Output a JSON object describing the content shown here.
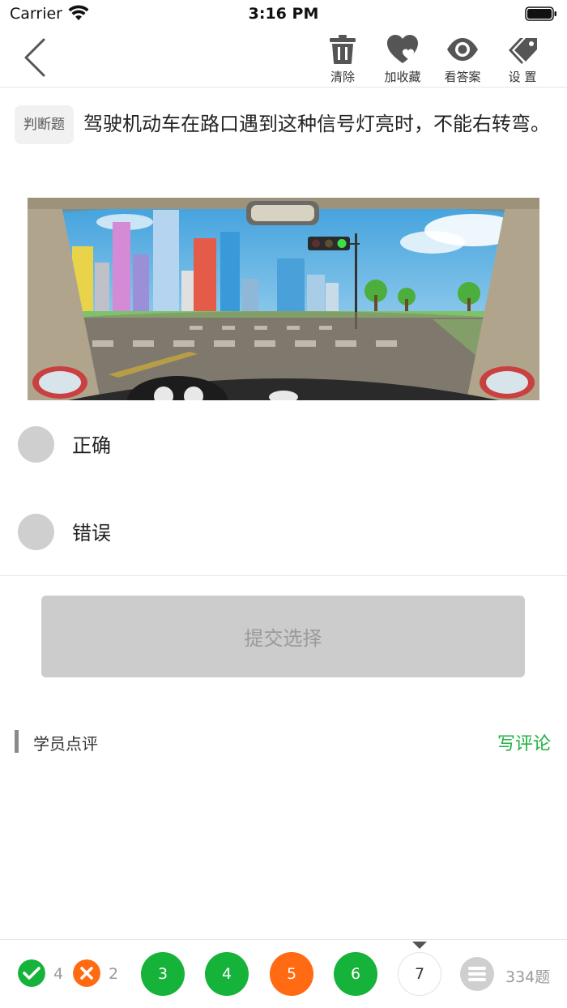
{
  "status_bar": {
    "carrier": "Carrier",
    "time": "3:16 PM"
  },
  "toolbar": {
    "back_icon": "chevron-left-icon",
    "items": [
      {
        "label": "清除",
        "icon": "trash-icon"
      },
      {
        "label": "加收藏",
        "icon": "heart-icon"
      },
      {
        "label": "看答案",
        "icon": "eye-icon"
      },
      {
        "label": "设 置",
        "icon": "tags-icon"
      }
    ]
  },
  "question": {
    "type_tag": "判断题",
    "text": "驾驶机动车在路口遇到这种信号灯亮时，不能右转弯。",
    "image_icon": "driver-view-traffic-light-illustration"
  },
  "options": [
    {
      "label": "正确"
    },
    {
      "label": "错误"
    }
  ],
  "submit_label": "提交选择",
  "comments": {
    "title": "学员点评",
    "write_label": "写评论"
  },
  "bottom_bar": {
    "correct_count": "4",
    "wrong_count": "2",
    "question_numbers": [
      {
        "num": "3",
        "state": "correct"
      },
      {
        "num": "4",
        "state": "correct"
      },
      {
        "num": "5",
        "state": "wrong"
      },
      {
        "num": "6",
        "state": "correct"
      },
      {
        "num": "7",
        "state": "current"
      }
    ],
    "total": "334题"
  },
  "colors": {
    "correct": "#16b33a",
    "wrong": "#ff6a12",
    "accent": "#20b040",
    "disabled_button": "#cccccc"
  }
}
